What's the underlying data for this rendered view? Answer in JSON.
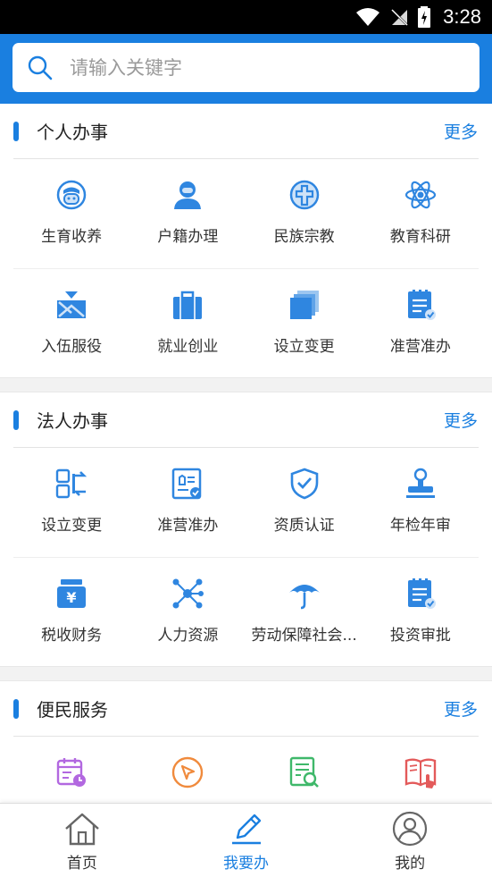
{
  "status_bar": {
    "time": "3:28"
  },
  "search": {
    "placeholder": "请输入关键字"
  },
  "colors": {
    "accent": "#1a7fe0",
    "icon_blue": "#2f86e0"
  },
  "sections": [
    {
      "title": "个人办事",
      "more": "更多",
      "items": [
        {
          "label": "生育收养",
          "icon": "baby-icon"
        },
        {
          "label": "户籍办理",
          "icon": "person-icon"
        },
        {
          "label": "民族宗教",
          "icon": "cross-icon"
        },
        {
          "label": "教育科研",
          "icon": "atom-icon"
        },
        {
          "label": "入伍服役",
          "icon": "enlist-icon"
        },
        {
          "label": "就业创业",
          "icon": "briefcase-icon"
        },
        {
          "label": "设立变更",
          "icon": "stack-icon"
        },
        {
          "label": "准营准办",
          "icon": "checklist-icon"
        }
      ]
    },
    {
      "title": "法人办事",
      "more": "更多",
      "items": [
        {
          "label": "设立变更",
          "icon": "swap-icon"
        },
        {
          "label": "准营准办",
          "icon": "certificate-icon"
        },
        {
          "label": "资质认证",
          "icon": "shield-check-icon"
        },
        {
          "label": "年检年审",
          "icon": "stamp-icon"
        },
        {
          "label": "税收财务",
          "icon": "tax-icon"
        },
        {
          "label": "人力资源",
          "icon": "network-icon"
        },
        {
          "label": "劳动保障社会...",
          "icon": "umbrella-icon"
        },
        {
          "label": "投资审批",
          "icon": "checklist-icon"
        }
      ]
    },
    {
      "title": "便民服务",
      "more": "更多",
      "items": [
        {
          "label": "",
          "icon": "calendar-clock-icon"
        },
        {
          "label": "",
          "icon": "cursor-icon"
        },
        {
          "label": "",
          "icon": "doc-search-icon"
        },
        {
          "label": "",
          "icon": "book-hand-icon"
        }
      ]
    }
  ],
  "bottom_nav": [
    {
      "label": "首页",
      "icon": "home-icon",
      "active": false
    },
    {
      "label": "我要办",
      "icon": "pen-icon",
      "active": true
    },
    {
      "label": "我的",
      "icon": "user-icon",
      "active": false
    }
  ]
}
